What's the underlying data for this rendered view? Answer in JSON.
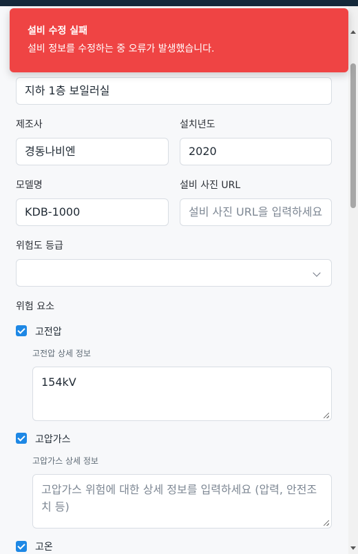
{
  "toast": {
    "title": "설비 수정 실패",
    "message": "설비 정보를 수정하는 중 오류가 발생했습니다."
  },
  "form": {
    "location_value": "지하 1층 보일러실",
    "manufacturer": {
      "label": "제조사",
      "value": "경동나비엔"
    },
    "install_year": {
      "label": "설치년도",
      "value": "2020"
    },
    "model": {
      "label": "모델명",
      "value": "KDB-1000"
    },
    "photo_url": {
      "label": "설비 사진 URL",
      "placeholder": "설비 사진 URL을 입력하세요"
    },
    "risk_grade": {
      "label": "위험도 등급",
      "value": ""
    },
    "risk_factors": {
      "label": "위험 요소",
      "high_voltage": {
        "label": "고전압",
        "checked": true,
        "detail_label": "고전압 상세 정보",
        "detail_value": "154kV"
      },
      "high_pressure_gas": {
        "label": "고압가스",
        "checked": true,
        "detail_label": "고압가스 상세 정보",
        "detail_placeholder": "고압가스 위험에 대한 상세 정보를 입력하세요 (압력, 안전조치 등)"
      },
      "high_temperature": {
        "label": "고온",
        "checked": true
      }
    }
  },
  "colors": {
    "toast_bg": "#ef4444",
    "checkbox": "#1e88e5",
    "topbar": "#14283a"
  }
}
